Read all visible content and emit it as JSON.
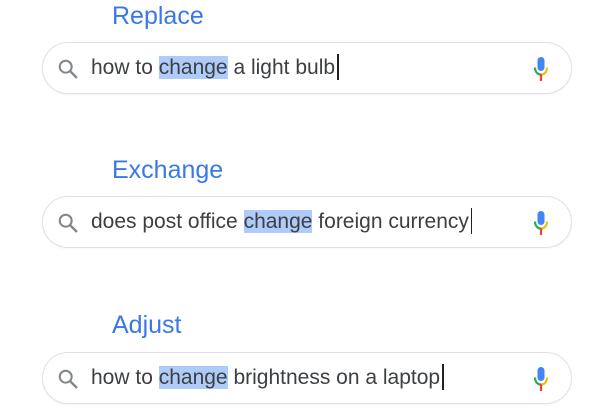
{
  "groups": [
    {
      "label": "Replace",
      "query_before": "how to ",
      "query_highlight": "change",
      "query_after": " a light bulb"
    },
    {
      "label": "Exchange",
      "query_before": "does post office ",
      "query_highlight": "change",
      "query_after": " foreign currency"
    },
    {
      "label": "Adjust",
      "query_before": "how to ",
      "query_highlight": "change",
      "query_after": " brightness on a laptop"
    }
  ],
  "icons": {
    "search": "search-icon",
    "mic": "mic-icon"
  },
  "colors": {
    "label": "#3b78e7",
    "highlight": "#aecbfa",
    "text": "#3c4043",
    "border": "#dfe1e5",
    "mic_blue": "#4285f4",
    "mic_red": "#ea4335",
    "mic_yellow": "#fbbc04",
    "mic_green": "#34a853"
  }
}
